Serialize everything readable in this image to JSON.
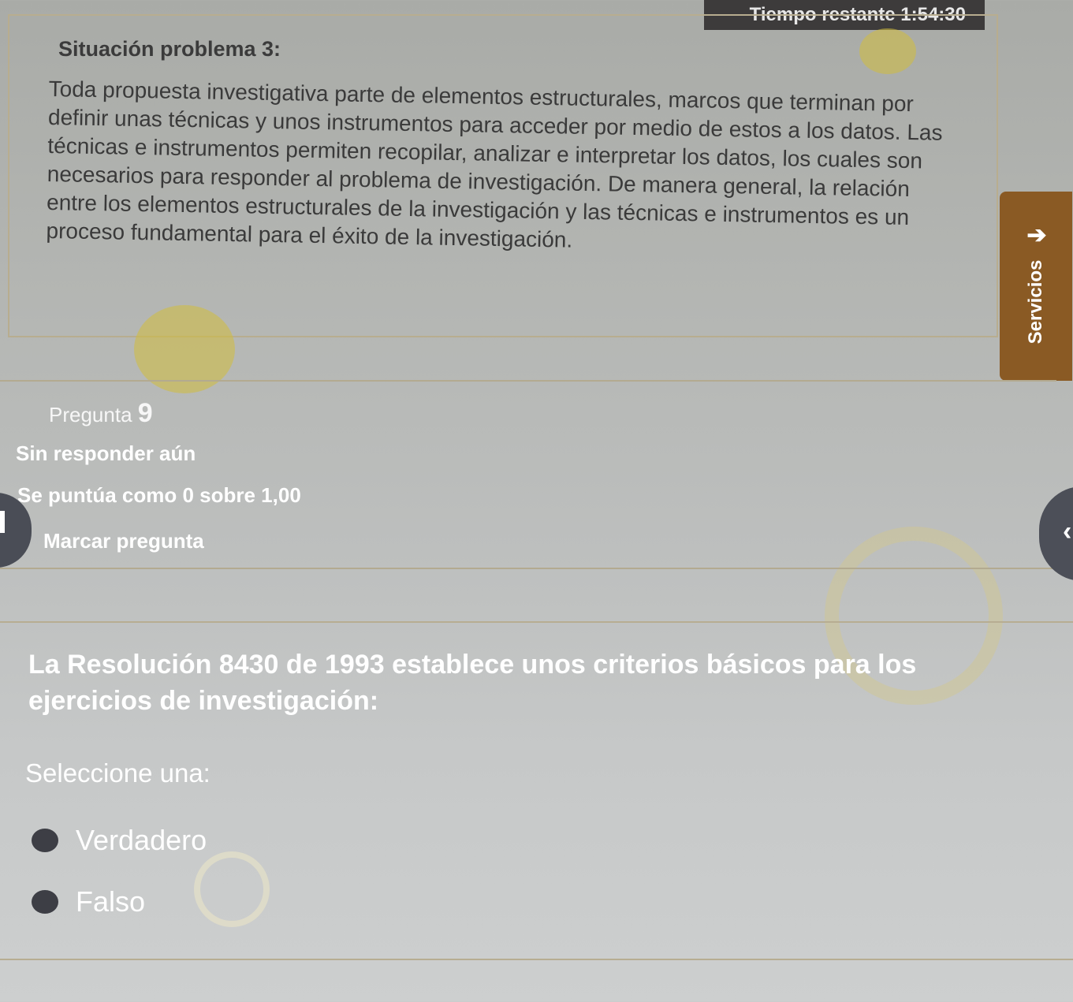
{
  "timer": {
    "label": "Tiempo restante 1:54:30"
  },
  "info": {
    "title": "Situación problema 3:",
    "text": "Toda propuesta investigativa parte de elementos estructurales, marcos que terminan por definir unas técnicas y unos instrumentos para acceder por medio de estos a los datos. Las técnicas e instrumentos permiten recopilar, analizar e interpretar los datos, los cuales son necesarios para responder al problema de investigación. De manera general, la relación entre los elementos estructurales de la investigación y las técnicas e instrumentos es un proceso fundamental para el éxito de la investigación."
  },
  "services_tab": {
    "label": "Servicios",
    "arrow": "➔"
  },
  "question_info": {
    "number_prefix": "Pregunta",
    "number": "9",
    "state": "Sin responder aún",
    "grade": "Se puntúa como 0 sobre 1,00",
    "flag_label": "Marcar pregunta"
  },
  "nav_handle": {
    "chevron": "‹"
  },
  "question": {
    "text": "La Resolución 8430 de 1993 establece unos criterios básicos para los ejercicios de investigación:",
    "prompt": "Seleccione una:",
    "options": [
      {
        "label": "Verdadero"
      },
      {
        "label": "Falso"
      }
    ]
  }
}
